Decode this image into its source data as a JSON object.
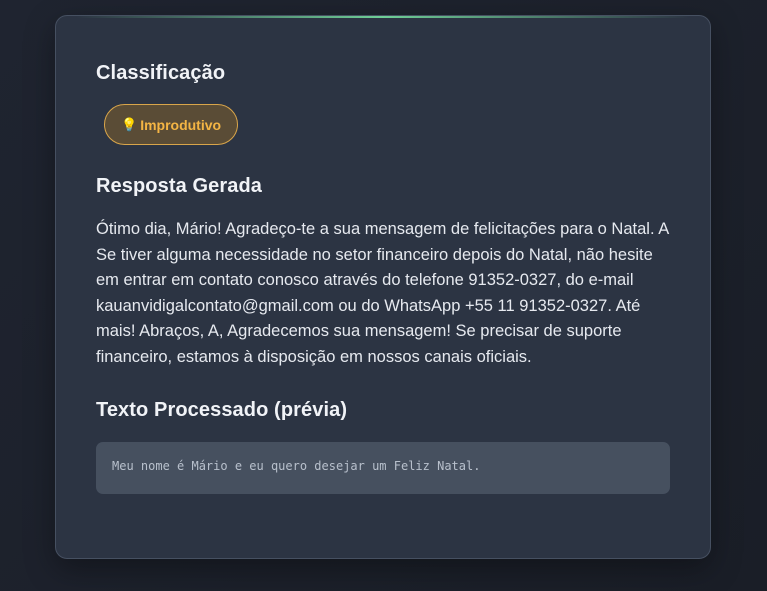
{
  "classification": {
    "title": "Classificação",
    "badge_icon": "lightbulb-icon",
    "badge_label": "Improdutivo",
    "badge_color": "#f4b544"
  },
  "response": {
    "title": "Resposta Gerada",
    "text": "Ótimo dia, Mário! Agradeço-te a sua mensagem de felicitações para o Natal. A Se tiver alguma necessidade no setor financeiro depois do Natal, não hesite em entrar em contato conosco através do telefone 91352-0327, do e-mail kauanvidigalcontato@gmail.com ou do WhatsApp +55 11 91352-0327. Até mais! Abraços, A, Agradecemos sua mensagem! Se precisar de suporte financeiro, estamos à disposição em nossos canais oficiais."
  },
  "processed": {
    "title": "Texto Processado (prévia)",
    "text": "Meu nome é Mário e eu quero desejar um Feliz Natal."
  }
}
